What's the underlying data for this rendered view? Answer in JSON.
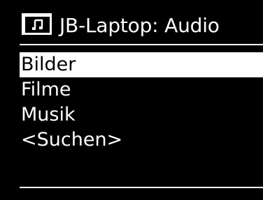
{
  "header": {
    "icon": "music-note-icon",
    "title": "JB-Laptop: Audio"
  },
  "menu": {
    "items": [
      {
        "label": "Bilder",
        "selected": true
      },
      {
        "label": "Filme",
        "selected": false
      },
      {
        "label": "Musik",
        "selected": false
      },
      {
        "label": "<Suchen>",
        "selected": false
      }
    ]
  },
  "colors": {
    "background": "#000000",
    "foreground": "#ffffff",
    "highlight": "#ffffff",
    "highlight_text": "#000000"
  }
}
